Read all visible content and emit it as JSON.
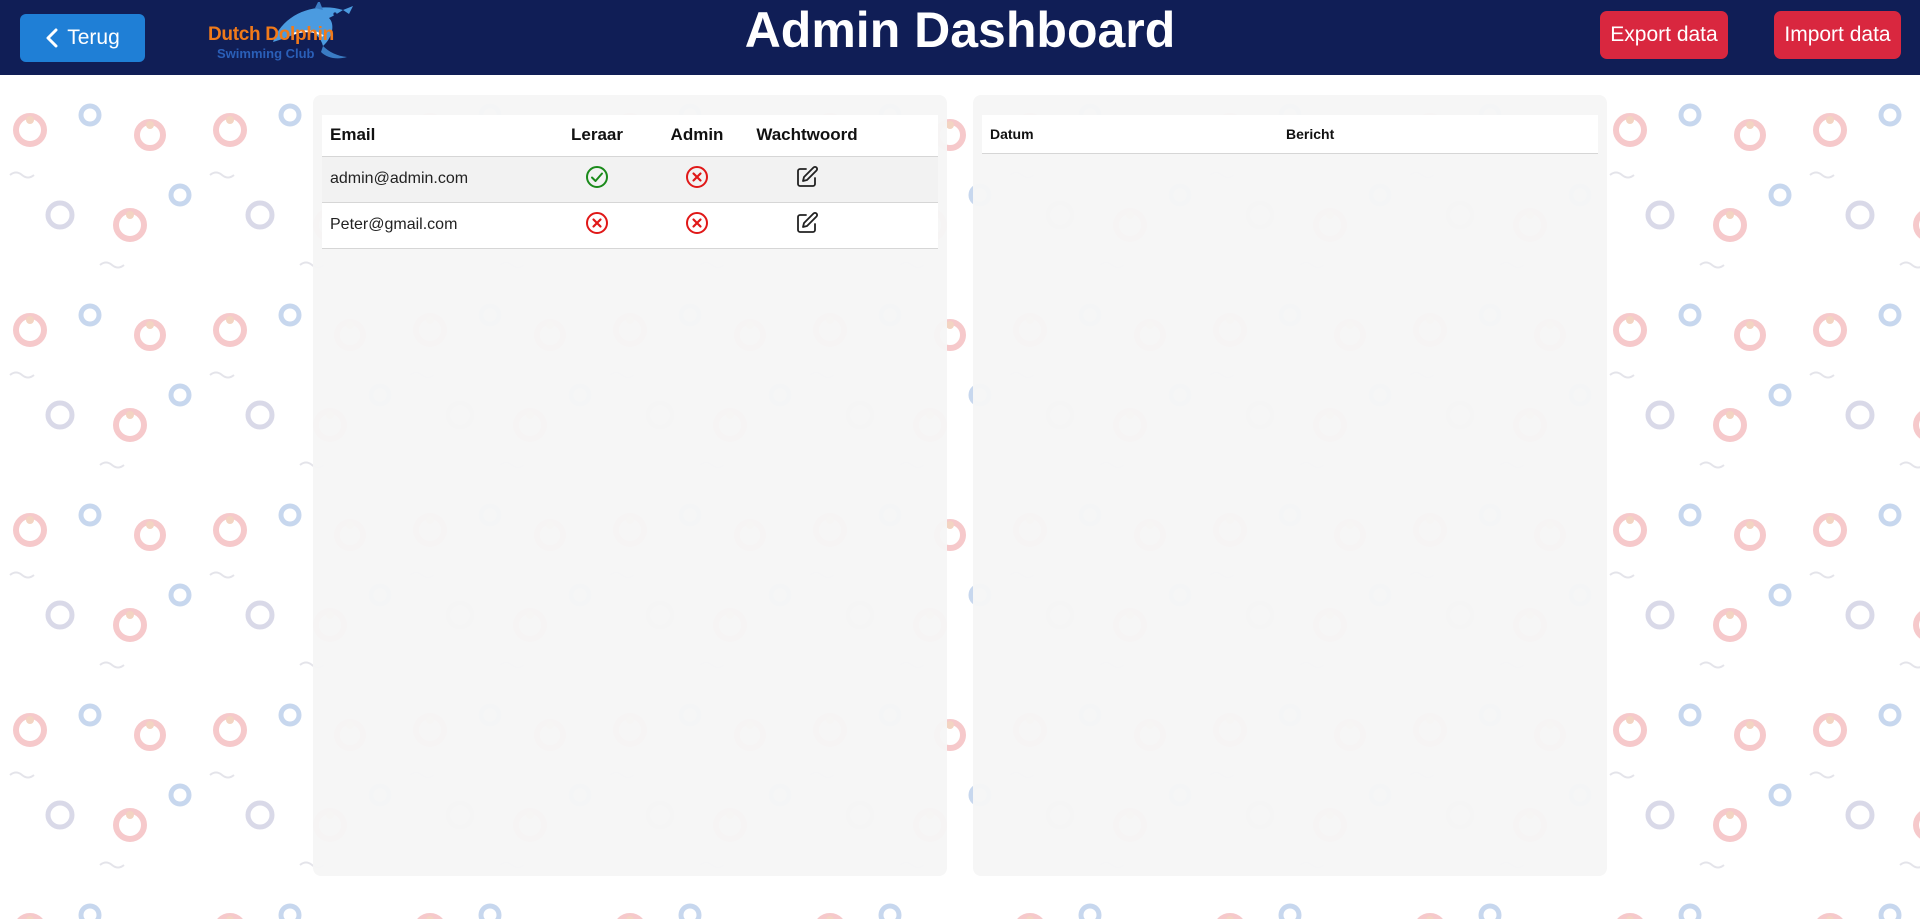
{
  "header": {
    "back_label": "Terug",
    "logo_line1": "Dutch Dolphin",
    "logo_line2": "Swimming Club",
    "title": "Admin Dashboard",
    "export_label": "Export data",
    "import_label": "Import data"
  },
  "users_table": {
    "columns": [
      "Email",
      "Leraar",
      "Admin",
      "Wachtwoord"
    ],
    "rows": [
      {
        "email": "admin@admin.com",
        "leraar": true,
        "admin": false,
        "edit_icon": "edit-icon"
      },
      {
        "email": "Peter@gmail.com",
        "leraar": false,
        "admin": false,
        "edit_icon": "edit-icon"
      }
    ]
  },
  "log_table": {
    "columns": [
      "Datum",
      "Bericht"
    ],
    "rows": []
  },
  "colors": {
    "header_bg": "#101e56",
    "back_button": "#1f7fd6",
    "action_button": "#d9273f",
    "check_green": "#1a8a1a",
    "cross_red": "#e01818"
  },
  "icons": {
    "check": "check-circle-icon",
    "cross": "x-circle-icon",
    "edit": "edit-icon",
    "back": "chevron-left-icon"
  }
}
